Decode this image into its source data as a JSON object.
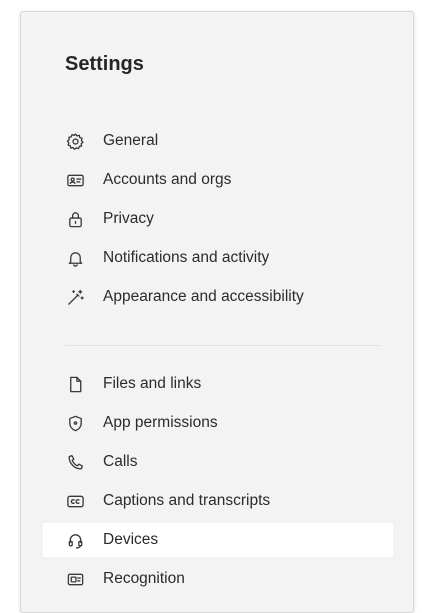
{
  "settings": {
    "title": "Settings",
    "selected": "Devices",
    "groups": [
      [
        {
          "label": "General",
          "icon": "gear-icon"
        },
        {
          "label": "Accounts and orgs",
          "icon": "id-card-icon"
        },
        {
          "label": "Privacy",
          "icon": "lock-icon"
        },
        {
          "label": "Notifications and activity",
          "icon": "bell-icon"
        },
        {
          "label": "Appearance and accessibility",
          "icon": "magic-wand-icon"
        }
      ],
      [
        {
          "label": "Files and links",
          "icon": "document-icon"
        },
        {
          "label": "App permissions",
          "icon": "shield-icon"
        },
        {
          "label": "Calls",
          "icon": "phone-icon"
        },
        {
          "label": "Captions and transcripts",
          "icon": "closed-captions-icon"
        },
        {
          "label": "Devices",
          "icon": "headset-icon"
        },
        {
          "label": "Recognition",
          "icon": "recognition-icon"
        }
      ]
    ]
  }
}
